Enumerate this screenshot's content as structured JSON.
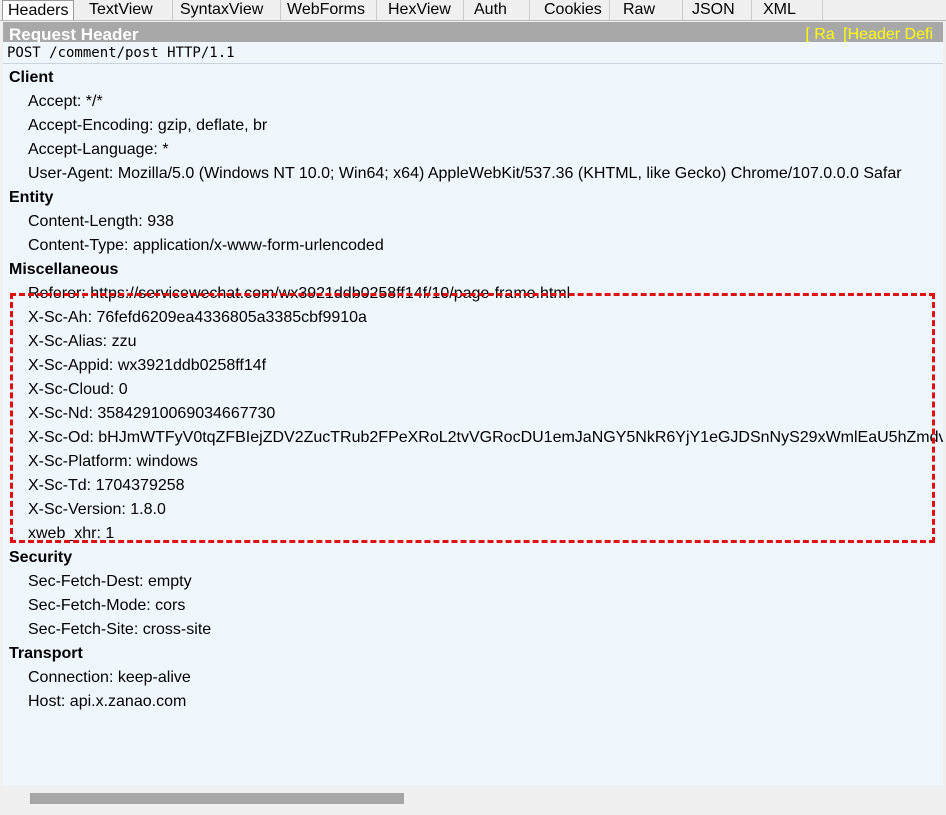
{
  "tabs": [
    {
      "label": "Headers",
      "active": true
    },
    {
      "label": "TextView"
    },
    {
      "label": "SyntaxView"
    },
    {
      "label": "WebForms"
    },
    {
      "label": "HexView"
    },
    {
      "label": "Auth"
    },
    {
      "label": "Cookies"
    },
    {
      "label": "Raw"
    },
    {
      "label": "JSON"
    },
    {
      "label": "XML"
    }
  ],
  "header_band": {
    "title": "Request Header",
    "links": [
      "[ Ra",
      "[Header Defi"
    ]
  },
  "request_line": "POST /comment/post HTTP/1.1",
  "groups": {
    "client": {
      "name": "Client",
      "items": [
        "Accept: */*",
        "Accept-Encoding: gzip, deflate, br",
        "Accept-Language: *",
        "User-Agent: Mozilla/5.0 (Windows NT 10.0; Win64; x64) AppleWebKit/537.36 (KHTML, like Gecko) Chrome/107.0.0.0 Safar"
      ]
    },
    "entity": {
      "name": "Entity",
      "items": [
        "Content-Length: 938",
        "Content-Type: application/x-www-form-urlencoded"
      ]
    },
    "misc": {
      "name": "Miscellaneous",
      "items": [
        "Referer: https://servicewechat.com/wx3921ddb0258ff14f/10/page-frame.html",
        "X-Sc-Ah: 76fefd6209ea4336805a3385cbf9910a",
        "X-Sc-Alias: zzu",
        "X-Sc-Appid: wx3921ddb0258ff14f",
        "X-Sc-Cloud: 0",
        "X-Sc-Nd: 35842910069034667730",
        "X-Sc-Od: bHJmWTFyV0tqZFBIejZDV2ZucTRub2FPeXRoL2tvVGRocDU1emJaNGY5NkR6YjY1eGJDSnNyS29xWmlEaU5hZmdve",
        "X-Sc-Platform: windows",
        "X-Sc-Td: 1704379258",
        "X-Sc-Version: 1.8.0",
        "xweb_xhr: 1"
      ]
    },
    "security": {
      "name": "Security",
      "items": [
        "Sec-Fetch-Dest: empty",
        "Sec-Fetch-Mode: cors",
        "Sec-Fetch-Site: cross-site"
      ]
    },
    "transport": {
      "name": "Transport",
      "items": [
        "Connection: keep-alive",
        "Host: api.x.zanao.com"
      ]
    }
  },
  "colors": {
    "highlight_border": "#e01010",
    "header_link": "#ffff00",
    "header_band": "#a8a8a8",
    "panel_bg": "#f0f7fc"
  }
}
